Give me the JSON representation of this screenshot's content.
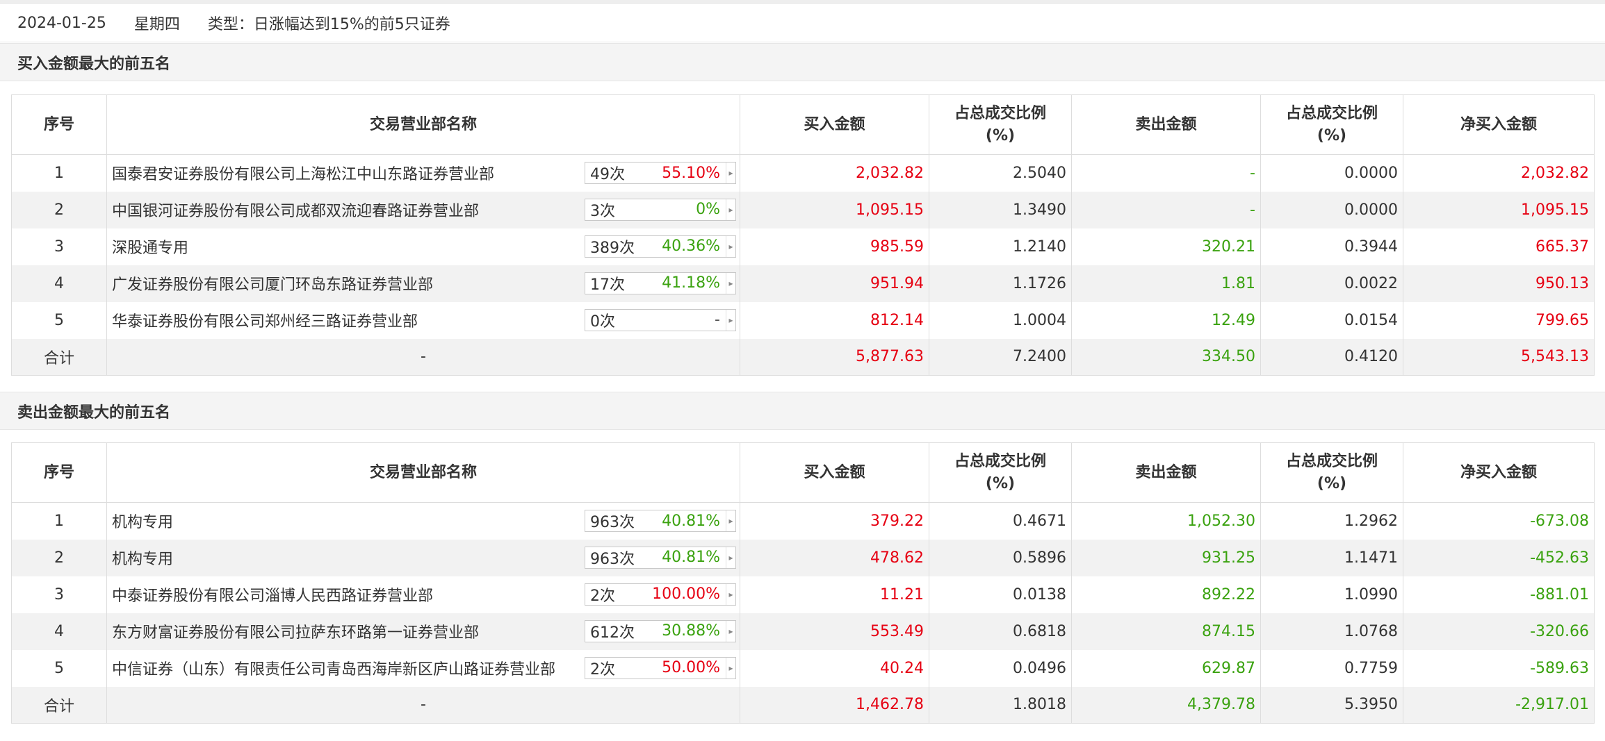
{
  "info": {
    "date": "2024-01-25",
    "weekday": "星期四",
    "type_text": "类型：日涨幅达到15%的前5只证券"
  },
  "headers": [
    "序号",
    "交易营业部名称",
    "买入金额",
    "占总成交比例(%)",
    "卖出金额",
    "占总成交比例(%)",
    "净买入金额"
  ],
  "header_ratio_line1": "占总成交比例",
  "header_ratio_line2": "(%)",
  "colors": {
    "up": "#e60012",
    "down": "#3aa20f"
  },
  "buy_section": {
    "title": "买入金额最大的前五名",
    "rows": [
      {
        "idx": "1",
        "name": "国泰君安证券股份有限公司上海松江中山东路证券营业部",
        "count": "49次",
        "rate": "55.10%",
        "rate_color": "red",
        "buy": "2,032.82",
        "buy_ratio": "2.5040",
        "sell": "-",
        "sell_ratio": "0.0000",
        "net": "2,032.82",
        "net_color": "red"
      },
      {
        "idx": "2",
        "name": "中国银河证券股份有限公司成都双流迎春路证券营业部",
        "count": "3次",
        "rate": "0%",
        "rate_color": "green",
        "buy": "1,095.15",
        "buy_ratio": "1.3490",
        "sell": "-",
        "sell_ratio": "0.0000",
        "net": "1,095.15",
        "net_color": "red"
      },
      {
        "idx": "3",
        "name": "深股通专用",
        "count": "389次",
        "rate": "40.36%",
        "rate_color": "green",
        "buy": "985.59",
        "buy_ratio": "1.2140",
        "sell": "320.21",
        "sell_ratio": "0.3944",
        "net": "665.37",
        "net_color": "red"
      },
      {
        "idx": "4",
        "name": "广发证券股份有限公司厦门环岛东路证券营业部",
        "count": "17次",
        "rate": "41.18%",
        "rate_color": "green",
        "buy": "951.94",
        "buy_ratio": "1.1726",
        "sell": "1.81",
        "sell_ratio": "0.0022",
        "net": "950.13",
        "net_color": "red"
      },
      {
        "idx": "5",
        "name": "华泰证券股份有限公司郑州经三路证券营业部",
        "count": "0次",
        "rate": "-",
        "rate_color": "plain",
        "buy": "812.14",
        "buy_ratio": "1.0004",
        "sell": "12.49",
        "sell_ratio": "0.0154",
        "net": "799.65",
        "net_color": "red"
      }
    ],
    "total": {
      "label": "合计",
      "name": "-",
      "buy": "5,877.63",
      "buy_ratio": "7.2400",
      "sell": "334.50",
      "sell_ratio": "0.4120",
      "net": "5,543.13",
      "net_color": "red"
    }
  },
  "sell_section": {
    "title": "卖出金额最大的前五名",
    "rows": [
      {
        "idx": "1",
        "name": "机构专用",
        "count": "963次",
        "rate": "40.81%",
        "rate_color": "green",
        "buy": "379.22",
        "buy_ratio": "0.4671",
        "sell": "1,052.30",
        "sell_ratio": "1.2962",
        "net": "-673.08",
        "net_color": "green"
      },
      {
        "idx": "2",
        "name": "机构专用",
        "count": "963次",
        "rate": "40.81%",
        "rate_color": "green",
        "buy": "478.62",
        "buy_ratio": "0.5896",
        "sell": "931.25",
        "sell_ratio": "1.1471",
        "net": "-452.63",
        "net_color": "green"
      },
      {
        "idx": "3",
        "name": "中泰证券股份有限公司淄博人民西路证券营业部",
        "count": "2次",
        "rate": "100.00%",
        "rate_color": "red",
        "buy": "11.21",
        "buy_ratio": "0.0138",
        "sell": "892.22",
        "sell_ratio": "1.0990",
        "net": "-881.01",
        "net_color": "green"
      },
      {
        "idx": "4",
        "name": "东方财富证券股份有限公司拉萨东环路第一证券营业部",
        "count": "612次",
        "rate": "30.88%",
        "rate_color": "green",
        "buy": "553.49",
        "buy_ratio": "0.6818",
        "sell": "874.15",
        "sell_ratio": "1.0768",
        "net": "-320.66",
        "net_color": "green"
      },
      {
        "idx": "5",
        "name": "中信证券（山东）有限责任公司青岛西海岸新区庐山路证券营业部",
        "count": "2次",
        "rate": "50.00%",
        "rate_color": "red",
        "buy": "40.24",
        "buy_ratio": "0.0496",
        "sell": "629.87",
        "sell_ratio": "0.7759",
        "net": "-589.63",
        "net_color": "green"
      }
    ],
    "total": {
      "label": "合计",
      "name": "-",
      "buy": "1,462.78",
      "buy_ratio": "1.8018",
      "sell": "4,379.78",
      "sell_ratio": "5.3950",
      "net": "-2,917.01",
      "net_color": "green"
    }
  }
}
